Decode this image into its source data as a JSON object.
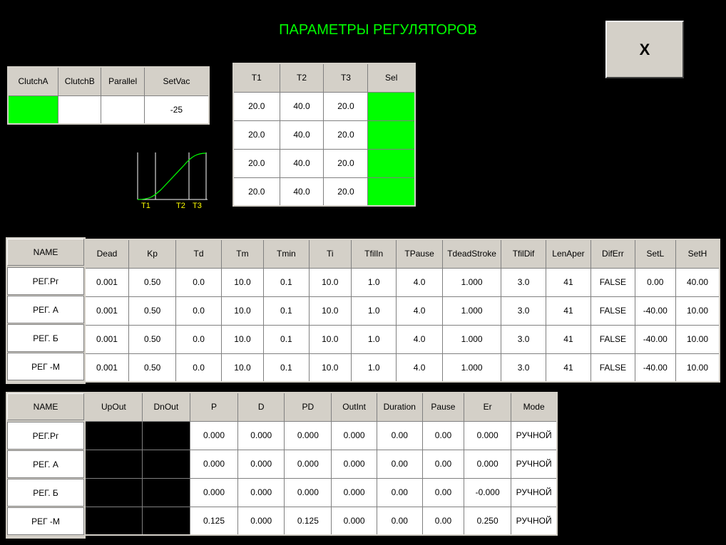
{
  "title": "ПАРАМЕТРЫ РЕГУЛЯТОРОВ",
  "close_label": "X",
  "clutch_table": {
    "headers": [
      "ClutchA",
      "ClutchB",
      "Parallel",
      "SetVac"
    ],
    "values": [
      "",
      "",
      "",
      "-25"
    ],
    "active": [
      true,
      false,
      false,
      false
    ]
  },
  "t_table": {
    "headers": [
      "T1",
      "T2",
      "T3",
      "Sel"
    ],
    "rows": [
      [
        "20.0",
        "40.0",
        "20.0",
        ""
      ],
      [
        "20.0",
        "40.0",
        "20.0",
        ""
      ],
      [
        "20.0",
        "40.0",
        "20.0",
        ""
      ],
      [
        "20.0",
        "40.0",
        "20.0",
        ""
      ]
    ]
  },
  "curve": {
    "labels": [
      "T1",
      "T2",
      "T3"
    ],
    "line_color": "#00ff00",
    "label_color": "#ffff00"
  },
  "params_table": {
    "name_header": "NAME",
    "names": [
      "РЕГ.Рг",
      "РЕГ. А",
      "РЕГ. Б",
      "РЕГ -М"
    ],
    "headers": [
      "Dead",
      "Kp",
      "Td",
      "Tm",
      "Tmin",
      "Ti",
      "TfilIn",
      "TPause",
      "TdeadStroke",
      "TfilDif",
      "LenAper",
      "DifErr",
      "SetL",
      "SetH"
    ],
    "rows": [
      [
        "0.001",
        "0.50",
        "0.0",
        "10.0",
        "0.1",
        "10.0",
        "1.0",
        "4.0",
        "1.000",
        "3.0",
        "41",
        "FALSE",
        "0.00",
        "40.00"
      ],
      [
        "0.001",
        "0.50",
        "0.0",
        "10.0",
        "0.1",
        "10.0",
        "1.0",
        "4.0",
        "1.000",
        "3.0",
        "41",
        "FALSE",
        "-40.00",
        "10.00"
      ],
      [
        "0.001",
        "0.50",
        "0.0",
        "10.0",
        "0.1",
        "10.0",
        "1.0",
        "4.0",
        "1.000",
        "3.0",
        "41",
        "FALSE",
        "-40.00",
        "10.00"
      ],
      [
        "0.001",
        "0.50",
        "0.0",
        "10.0",
        "0.1",
        "10.0",
        "1.0",
        "4.0",
        "1.000",
        "3.0",
        "41",
        "FALSE",
        "-40.00",
        "10.00"
      ]
    ]
  },
  "output_table": {
    "name_header": "NAME",
    "names": [
      "РЕГ.Рг",
      "РЕГ. А",
      "РЕГ. Б",
      "РЕГ -М"
    ],
    "headers": [
      "UpOut",
      "DnOut",
      "P",
      "D",
      "PD",
      "OutInt",
      "Duration",
      "Pause",
      "Er",
      "Mode"
    ],
    "rows": [
      [
        "",
        "",
        "0.000",
        "0.000",
        "0.000",
        "0.000",
        "0.00",
        "0.00",
        "0.000",
        "РУЧНОЙ"
      ],
      [
        "",
        "",
        "0.000",
        "0.000",
        "0.000",
        "0.000",
        "0.00",
        "0.00",
        "0.000",
        "РУЧНОЙ"
      ],
      [
        "",
        "",
        "0.000",
        "0.000",
        "0.000",
        "0.000",
        "0.00",
        "0.00",
        "-0.000",
        "РУЧНОЙ"
      ],
      [
        "",
        "",
        "0.125",
        "0.000",
        "0.125",
        "0.000",
        "0.00",
        "0.00",
        "0.250",
        "РУЧНОЙ"
      ]
    ]
  },
  "colors": {
    "active": "#00ff00",
    "inactive_output": "#000000",
    "title": "#00ff00"
  }
}
